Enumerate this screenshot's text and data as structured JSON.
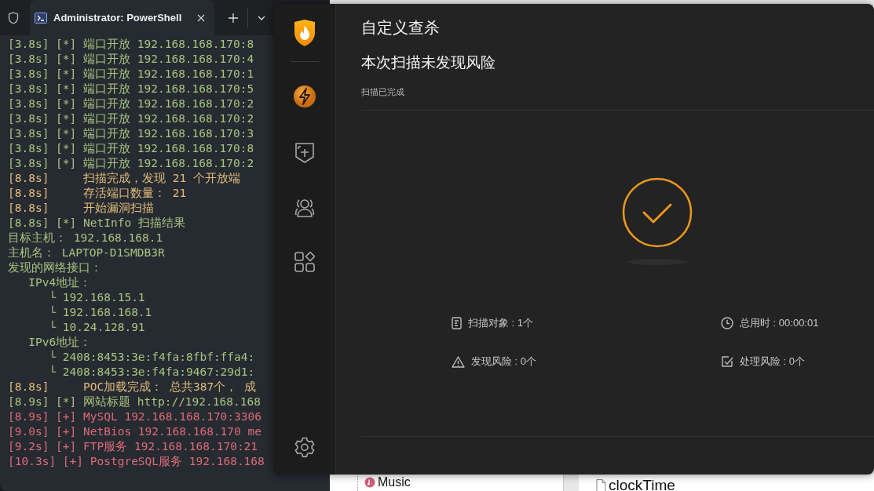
{
  "terminal": {
    "tabs": [
      {
        "title": "Administrator: PowerShell",
        "selected": true
      }
    ],
    "lines": [
      {
        "text": "[3.8s] [*] 端口开放 192.168.168.170:8",
        "kind": "info"
      },
      {
        "text": "[3.8s] [*] 端口开放 192.168.168.170:4",
        "kind": "info"
      },
      {
        "text": "[3.8s] [*] 端口开放 192.168.168.170:1",
        "kind": "info"
      },
      {
        "text": "[3.8s] [*] 端口开放 192.168.168.170:5",
        "kind": "info"
      },
      {
        "text": "[3.8s] [*] 端口开放 192.168.168.170:2",
        "kind": "info"
      },
      {
        "text": "[3.8s] [*] 端口开放 192.168.168.170:2",
        "kind": "info"
      },
      {
        "text": "[3.8s] [*] 端口开放 192.168.168.170:3",
        "kind": "info"
      },
      {
        "text": "[3.8s] [*] 端口开放 192.168.168.170:8",
        "kind": "info"
      },
      {
        "text": "[3.8s] [*] 端口开放 192.168.168.170:2",
        "kind": "info"
      },
      {
        "text": "[8.8s]     扫描完成，发现 21 个开放端",
        "kind": "status"
      },
      {
        "text": "[8.8s]     存活端口数量： 21",
        "kind": "status"
      },
      {
        "text": "[8.8s]     开始漏洞扫描",
        "kind": "status"
      },
      {
        "text": "[8.8s] [*] NetInfo 扫描结果",
        "kind": "info"
      },
      {
        "text": "目标主机： 192.168.168.1",
        "kind": "info"
      },
      {
        "text": "主机名： LAPTOP-D1SMDB3R",
        "kind": "info"
      },
      {
        "text": "发现的网络接口：",
        "kind": "info"
      },
      {
        "text": "   IPv4地址：",
        "kind": "info"
      },
      {
        "text": "      └ 192.168.15.1",
        "kind": "info"
      },
      {
        "text": "      └ 192.168.168.1",
        "kind": "info"
      },
      {
        "text": "      └ 10.24.128.91",
        "kind": "info"
      },
      {
        "text": "   IPv6地址：",
        "kind": "info"
      },
      {
        "text": "      └ 2408:8453:3e:f4fa:8fbf:ffa4:",
        "kind": "info"
      },
      {
        "text": "      └ 2408:8453:3e:f4fa:9467:29d1:",
        "kind": "info"
      },
      {
        "text": "[8.8s]     POC加载完成： 总共387个， 成",
        "kind": "status"
      },
      {
        "text": "[8.9s] [*] 网站标题 http://192.168.168",
        "kind": "info"
      },
      {
        "text": "[8.9s] [+] MySQL 192.168.168.170:3306",
        "kind": "found"
      },
      {
        "text": "[9.0s] [+] NetBios 192.168.168.170 me",
        "kind": "found"
      },
      {
        "text": "[9.2s] [+] FTP服务 192.168.168.170:21",
        "kind": "found"
      },
      {
        "text": "[10.3s] [+] PostgreSQL服务 192.168.168",
        "kind": "found"
      }
    ]
  },
  "scanner": {
    "title": "自定义查杀",
    "headline": "本次扫描未发现风险",
    "status": "扫描已完成",
    "stats": [
      {
        "kind": "targets",
        "text": "扫描对象 : 1个"
      },
      {
        "kind": "time",
        "text": "总用时 : 00:00:01"
      },
      {
        "kind": "risks",
        "text": "发现风险 : 0个"
      },
      {
        "kind": "handled",
        "text": "处理风险 : 0个"
      }
    ]
  },
  "background_window": {
    "items": [
      {
        "kind": "folder",
        "label": "Music"
      },
      {
        "kind": "file",
        "label": "clockTime"
      }
    ]
  }
}
